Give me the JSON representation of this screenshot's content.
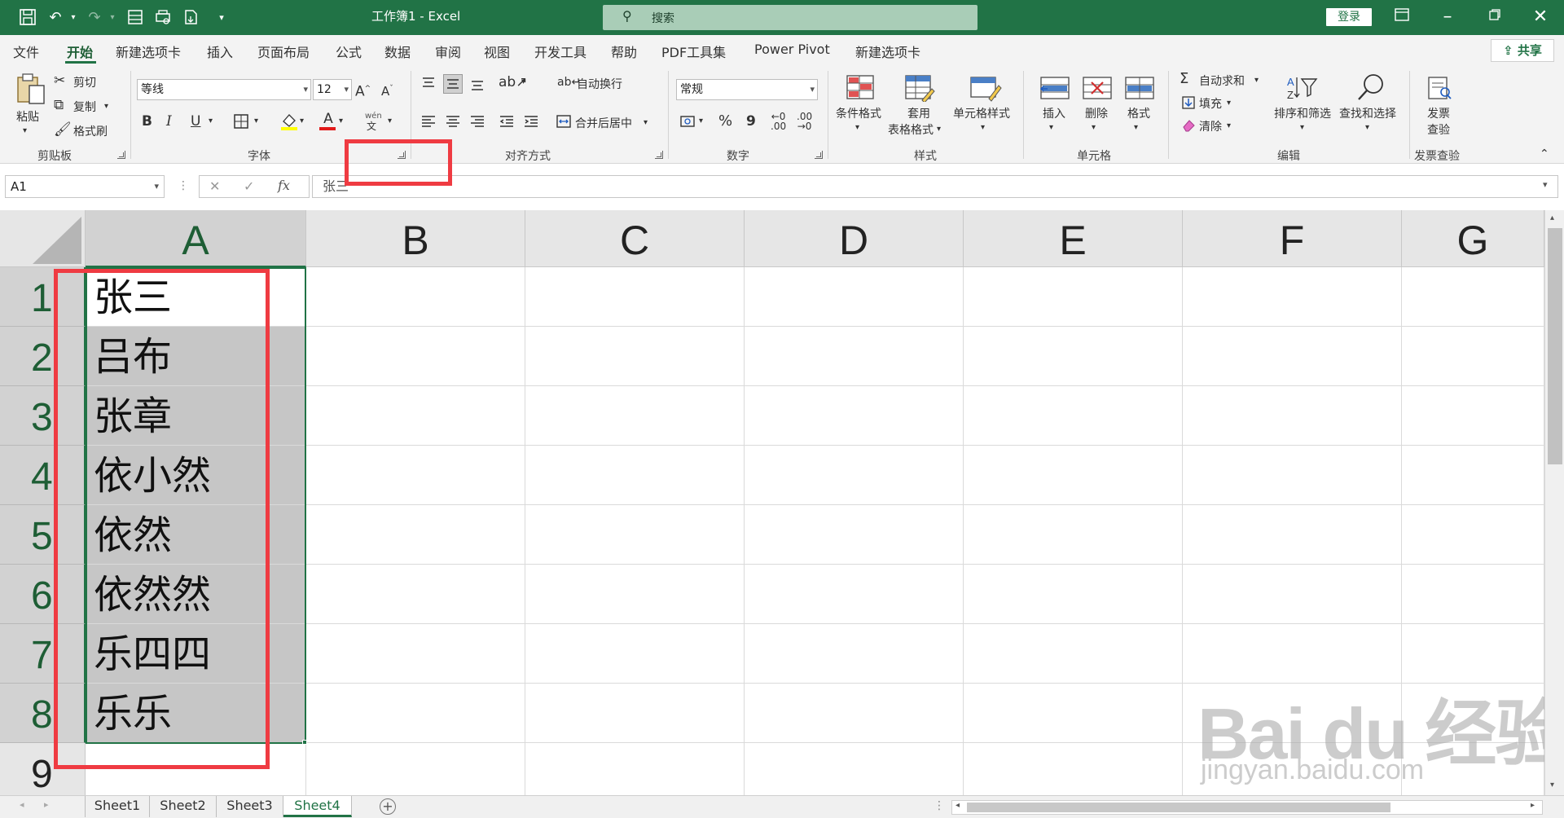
{
  "titlebar": {
    "title": "工作簿1  -  Excel",
    "search_placeholder": "搜索",
    "login": "登录",
    "icons": [
      "save-icon",
      "undo-icon",
      "redo-icon",
      "form-icon",
      "print-preview-icon",
      "export-icon",
      "customize-icon"
    ]
  },
  "menu": {
    "tabs": [
      "文件",
      "开始",
      "新建选项卡",
      "插入",
      "页面布局",
      "公式",
      "数据",
      "审阅",
      "视图",
      "开发工具",
      "帮助",
      "PDF工具集",
      "Power Pivot",
      "新建选项卡"
    ],
    "active": "开始",
    "share": "共享"
  },
  "ribbon": {
    "clipboard": {
      "paste": "粘贴",
      "cut": "剪切",
      "copy": "复制",
      "format_painter": "格式刷",
      "label": "剪贴板"
    },
    "font": {
      "name": "等线",
      "size": "12",
      "bold": "B",
      "italic": "I",
      "underline": "U",
      "label": "字体",
      "phonetic": "wén"
    },
    "alignment": {
      "wrap": "自动换行",
      "merge": "合并后居中",
      "label": "对齐方式"
    },
    "number": {
      "format": "常规",
      "percent": "%",
      "comma": "9",
      "label": "数字"
    },
    "styles": {
      "conditional": "条件格式",
      "table_format_1": "套用",
      "table_format_2": "表格格式",
      "cell_styles": "单元格样式",
      "label": "样式"
    },
    "cells": {
      "insert": "插入",
      "delete": "删除",
      "format": "格式",
      "label": "单元格"
    },
    "editing": {
      "autosum": "自动求和",
      "fill": "填充",
      "clear": "清除",
      "sort": "排序和筛选",
      "find": "查找和选择",
      "label": "编辑"
    },
    "invoice": {
      "check_1": "发票",
      "check_2": "查验",
      "label": "发票查验"
    }
  },
  "formula_bar": {
    "name_box": "A1",
    "content": "张三"
  },
  "sheet": {
    "columns": [
      "A",
      "B",
      "C",
      "D",
      "E",
      "F",
      "G"
    ],
    "rows": [
      "1",
      "2",
      "3",
      "4",
      "5",
      "6",
      "7",
      "8",
      "9"
    ],
    "column_a": [
      "张三",
      "吕布",
      "张章",
      "依小然",
      "依然",
      "依然然",
      "乐四四",
      "乐乐",
      ""
    ]
  },
  "tabs": {
    "sheets": [
      "Sheet1",
      "Sheet2",
      "Sheet3",
      "Sheet4"
    ],
    "active": "Sheet4"
  },
  "watermark": {
    "brand": "Bai du 经验",
    "url": "jingyan.baidu.com"
  },
  "colors": {
    "excel_green": "#217346",
    "highlight_red": "#ef3b42",
    "selection_gray": "#c6c6c6"
  }
}
